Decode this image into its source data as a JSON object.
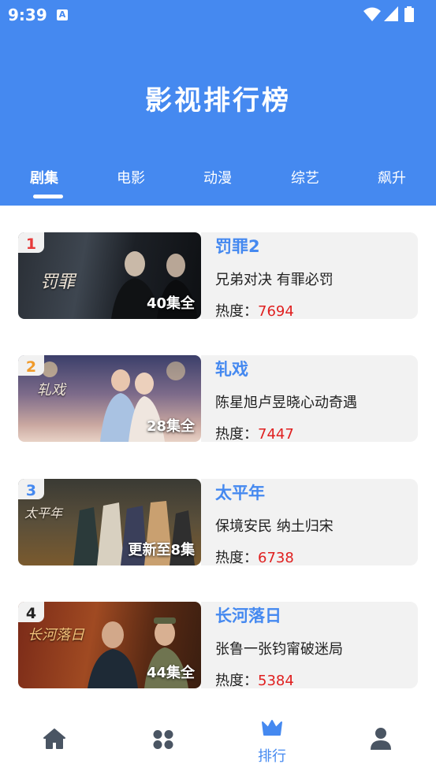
{
  "status_bar": {
    "time": "9:39",
    "notification_icon_letter": "A"
  },
  "header": {
    "title": "影视排行榜"
  },
  "tabs": [
    {
      "label": "剧集",
      "active": true
    },
    {
      "label": "电影",
      "active": false
    },
    {
      "label": "动漫",
      "active": false
    },
    {
      "label": "综艺",
      "active": false
    },
    {
      "label": "飙升",
      "active": false
    }
  ],
  "heat_label": "热度：",
  "items": [
    {
      "rank": "1",
      "rank_color": "#E63A3A",
      "name": "罚罪2",
      "desc": "兄弟对决 有罪必罚",
      "heat": "7694",
      "episodes": "40集全",
      "poster_text": "罚罪"
    },
    {
      "rank": "2",
      "rank_color": "#F09A2A",
      "name": "轧戏",
      "desc": "陈星旭卢昱晓心动奇遇",
      "heat": "7447",
      "episodes": "28集全",
      "poster_text": "轧戏"
    },
    {
      "rank": "3",
      "rank_color": "#4589F0",
      "name": "太平年",
      "desc": "保境安民 纳土归宋",
      "heat": "6738",
      "episodes": "更新至8集",
      "poster_text": "太平年"
    },
    {
      "rank": "4",
      "rank_color": "#222222",
      "name": "长河落日",
      "desc": "张鲁一张钧甯破迷局",
      "heat": "5384",
      "episodes": "44集全",
      "poster_text": "长河落日"
    }
  ],
  "bottom_nav": {
    "home_icon": "home-icon",
    "category_icon": "grid-icon",
    "ranking_icon": "crown-icon",
    "ranking_label": "排行",
    "profile_icon": "user-icon"
  },
  "colors": {
    "primary": "#4589F0",
    "heat_value": "#E02020",
    "card_bg": "#F2F2F2"
  }
}
